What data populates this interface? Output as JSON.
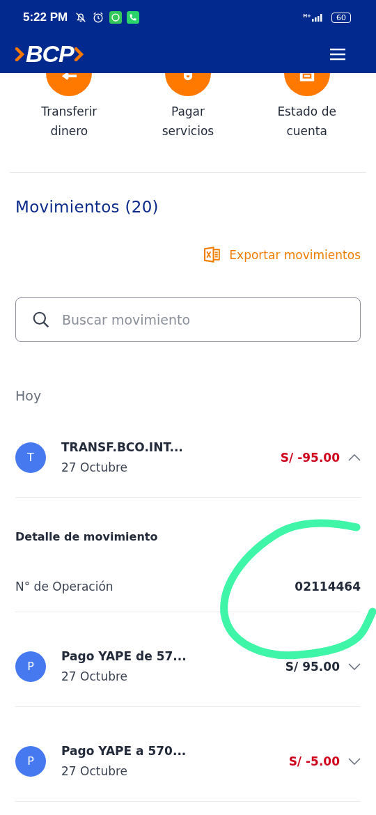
{
  "status_bar": {
    "time": "5:22 PM",
    "network": "H+",
    "battery": "60"
  },
  "header": {
    "logo": "BCP"
  },
  "actions": [
    {
      "kind": "transfer",
      "label": "Transferir dinero"
    },
    {
      "kind": "pay",
      "label": "Pagar servicios"
    },
    {
      "kind": "statement",
      "label": "Estado de cuenta"
    }
  ],
  "movements": {
    "title": "Movimientos (20)",
    "export": "Exportar movimientos",
    "search": {
      "placeholder": "Buscar movimiento"
    },
    "group": "Hoy",
    "items": [
      {
        "initial": "T",
        "name": "TRANSF.BCO.INT...",
        "date": "27 Octubre",
        "amount": "S/ -95.00",
        "negative": true,
        "expanded": true,
        "detail": {
          "title": "Detalle de movimiento",
          "label": "N° de Operación",
          "value": "02114464"
        }
      },
      {
        "initial": "P",
        "name": "Pago YAPE de 57...",
        "date": "27 Octubre",
        "amount": "S/ 95.00",
        "negative": false,
        "expanded": false
      },
      {
        "initial": "P",
        "name": "Pago YAPE a 570...",
        "date": "27 Octubre",
        "amount": "S/ -5.00",
        "negative": true,
        "expanded": false
      }
    ]
  }
}
